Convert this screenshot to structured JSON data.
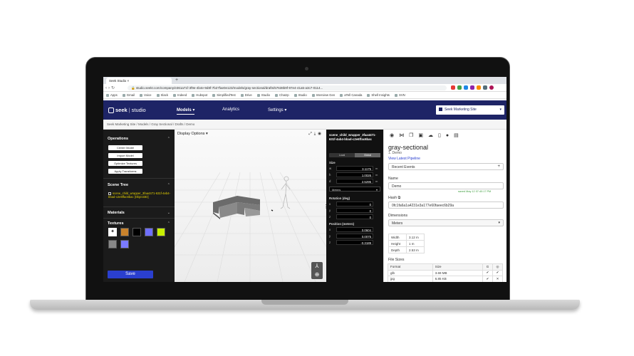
{
  "browser": {
    "tab_title": "Seek Studio",
    "new_tab": "+",
    "url": "studio.seekr.com/company/e361a71f-3f9e-4b4e-9d8f-7b27fae0e123/models/gray-sectional/drafts/57638b9f-97e4-41a5-a3c7-0114...",
    "bookmarks": [
      "Apps",
      "Gmail",
      "Voice",
      "Slack",
      "Indeed",
      "Hubspot",
      "SimplifiedTest",
      "Drive",
      "Studio",
      "ChatJp",
      "Studio",
      "Interview Gen",
      "aTell Canada",
      "Shell Insights",
      "SVN"
    ]
  },
  "app_nav": {
    "logo_brand": "seek",
    "logo_product": "studio",
    "items": [
      "Models ▾",
      "Analytics",
      "Settings ▾"
    ],
    "site_selector": "Seek Marketing Site"
  },
  "breadcrumb": "Seek Marketing Site / Models / Gray Sectional / Drafts / Demo",
  "left_panel": {
    "operations_title": "Operations",
    "operations": [
      "Center Model",
      "Import Model",
      "Optimize Textures",
      "Apply Transforms"
    ],
    "scene_tree_title": "Scene Tree",
    "scene_tree_item": "scene_child_wrapper_3faa4471-631f-4eb4-bbad-c2e6ffac6bac [Object3D]",
    "materials_title": "Materials",
    "textures_title": "Textures",
    "save_label": "Save"
  },
  "viewport": {
    "display_options": "Display Options ▾"
  },
  "properties": {
    "object_name": "scene_child_wrapper_3faa4471-631f-4ab4-bbad-c2e6ffac6bac",
    "toggle": [
      "Local",
      "Global"
    ],
    "size_title": "Size",
    "size": [
      {
        "axis": "w",
        "value": "3.1175",
        "unit": "m"
      },
      {
        "axis": "h",
        "value": "1.0026",
        "unit": "m"
      },
      {
        "axis": "d",
        "value": "2.5295",
        "unit": "m"
      }
    ],
    "size_unit": "Meters",
    "rotation_title": "Rotation (deg)",
    "rotation": [
      {
        "axis": "x",
        "value": "0"
      },
      {
        "axis": "y",
        "value": "0"
      },
      {
        "axis": "z",
        "value": "0"
      }
    ],
    "position_title": "Position (meters)",
    "position": [
      {
        "axis": "x",
        "value": "0.0604"
      },
      {
        "axis": "y",
        "value": "0.0075"
      },
      {
        "axis": "z",
        "value": "-0.3189"
      }
    ]
  },
  "right_panel": {
    "title": "gray-sectional",
    "subtitle": "1. Demo",
    "pipeline_link": "View Latest Pipeline",
    "recent_events": "Recent Events",
    "name_label": "Name",
    "name_value": "Demo",
    "saved_text": "saved May 12 07:40:17 PM",
    "hash_label": "Hash",
    "hash_value": "0fc1fa6a1a4231e3a177e60faeec6b29a",
    "dimensions_label": "Dimensions",
    "dimensions_unit": "Meters",
    "dims": [
      {
        "label": "Width",
        "value": "3.12 m"
      },
      {
        "label": "Height",
        "value": "1 m"
      },
      {
        "label": "Depth",
        "value": "2.53 m"
      }
    ],
    "file_sizes_label": "File Sizes",
    "file_headers": [
      "Format",
      "Size",
      "G",
      "◎"
    ],
    "files": [
      {
        "format": "glb",
        "size": "3.69 MB",
        "g": "✔",
        "a": "✔"
      },
      {
        "format": "jpg",
        "size": "6.85 KB",
        "g": "✔",
        "a": "✕"
      },
      {
        "format": "usdz",
        "size": "3.7 MB",
        "g": "",
        "a": "✔"
      }
    ]
  },
  "colors": {
    "nav_bg": "#1e2466",
    "accent": "#2a3fcf",
    "panel_dark": "#1b1b1b",
    "tree_highlight": "#e6d200",
    "textures": [
      "#ffffff",
      "#c9832c",
      "#000000",
      "#6f6fff",
      "#c8f000",
      "#888888",
      "#7a7aff"
    ]
  }
}
